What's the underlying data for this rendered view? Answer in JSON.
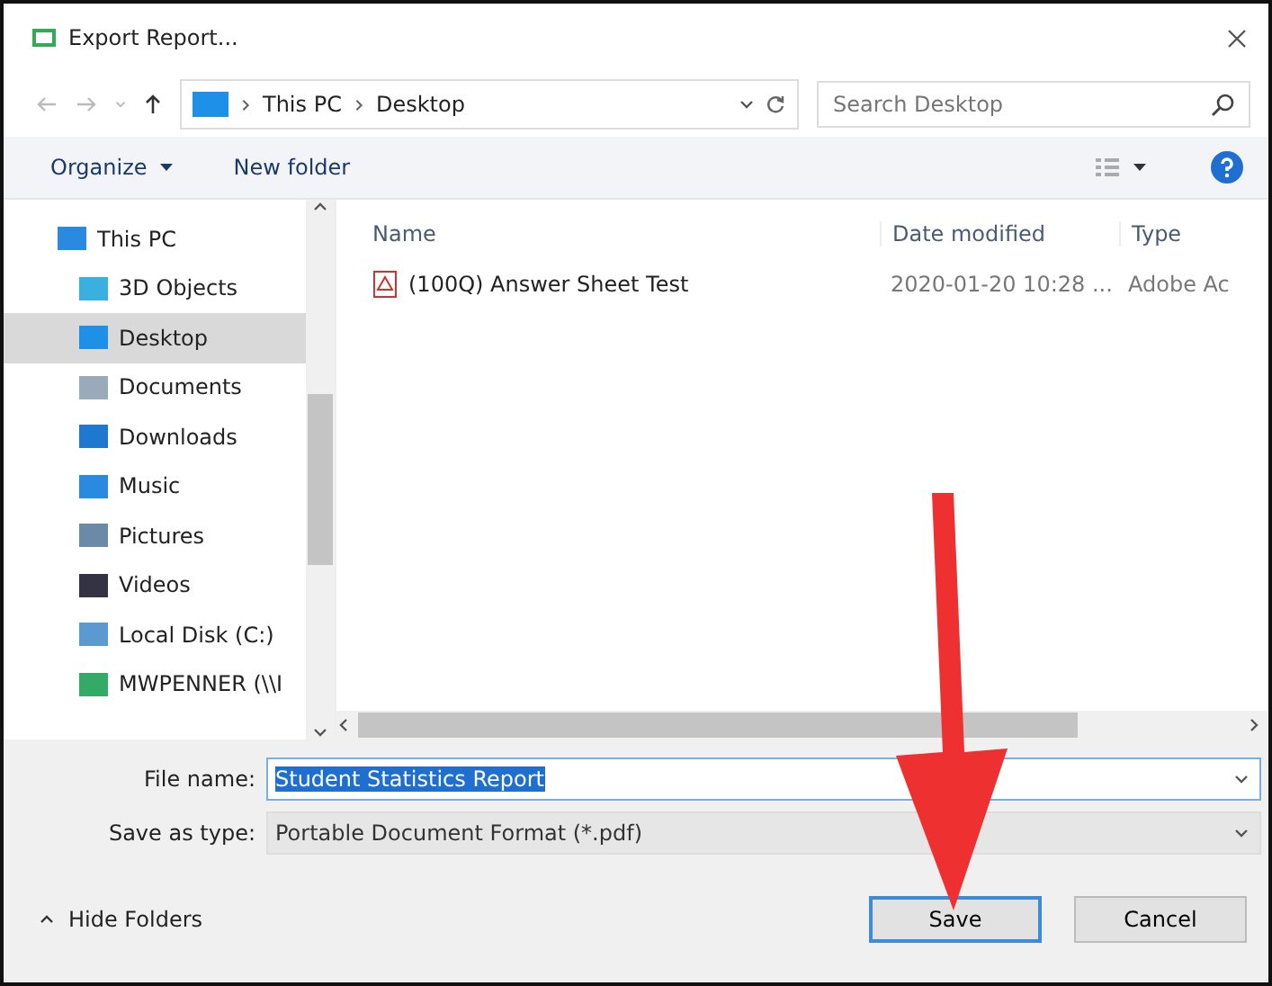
{
  "window": {
    "title": "Export Report..."
  },
  "address_bar": {
    "path": [
      {
        "label": "This PC"
      },
      {
        "label": "Desktop"
      }
    ]
  },
  "search": {
    "placeholder": "Search Desktop"
  },
  "toolbar": {
    "organize": "Organize",
    "new_folder": "New folder"
  },
  "sidebar": {
    "items": [
      {
        "label": "This PC",
        "kind": "pc",
        "selected": false,
        "children": [
          {
            "label": "3D Objects",
            "kind": "objects3d",
            "selected": false
          },
          {
            "label": "Desktop",
            "kind": "desktop",
            "selected": true
          },
          {
            "label": "Documents",
            "kind": "documents",
            "selected": false
          },
          {
            "label": "Downloads",
            "kind": "downloads",
            "selected": false
          },
          {
            "label": "Music",
            "kind": "music",
            "selected": false
          },
          {
            "label": "Pictures",
            "kind": "pictures",
            "selected": false
          },
          {
            "label": "Videos",
            "kind": "videos",
            "selected": false
          },
          {
            "label": "Local Disk (C:)",
            "kind": "disk",
            "selected": false
          },
          {
            "label": "MWPENNER (\\\\I",
            "kind": "network",
            "selected": false
          }
        ]
      }
    ]
  },
  "file_list": {
    "columns": [
      "Name",
      "Date modified",
      "Type"
    ],
    "rows": [
      {
        "name": "(100Q) Answer Sheet Test",
        "date": "2020-01-20 10:28 ...",
        "type": "Adobe Ac"
      }
    ]
  },
  "form": {
    "file_name_label": "File name:",
    "file_name": "Student Statistics Report",
    "save_type_label": "Save as type:",
    "save_type": "Portable Document Format (*.pdf)"
  },
  "footer": {
    "hide_folders": "Hide Folders",
    "buttons": [
      {
        "label": "Save",
        "kind": "primary"
      },
      {
        "label": "Cancel",
        "kind": "secondary"
      }
    ]
  }
}
